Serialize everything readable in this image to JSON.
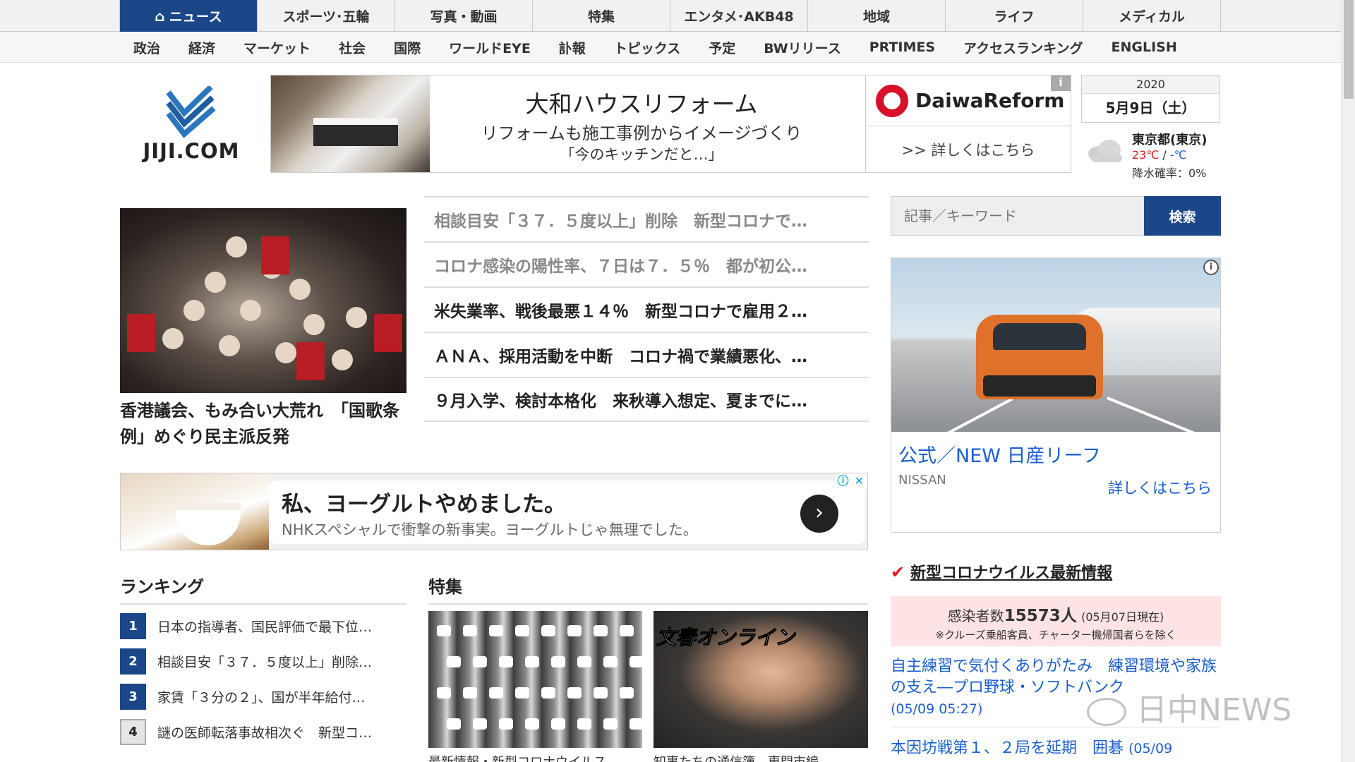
{
  "topnav": {
    "tabs": [
      {
        "label": "ニュース",
        "icon": "home-icon"
      },
      {
        "label": "スポーツ･五輪"
      },
      {
        "label": "写真・動画"
      },
      {
        "label": "特集"
      },
      {
        "label": "エンタメ･AKB48"
      },
      {
        "label": "地域"
      },
      {
        "label": "ライフ"
      },
      {
        "label": "メディカル"
      }
    ],
    "active_color": "#1b4788"
  },
  "subnav": {
    "items": [
      "政治",
      "経済",
      "マーケット",
      "社会",
      "国際",
      "ワールドEYE",
      "訃報",
      "トピックス",
      "予定",
      "BWリリース",
      "PRTIMES",
      "アクセスランキング",
      "ENGLISH"
    ]
  },
  "header": {
    "logo_text": "JIJI.COM",
    "banner": {
      "title": "大和ハウスリフォーム",
      "subtitle": "リフォームも施工事例からイメージづくり",
      "caption": "「今のキッチンだと…」",
      "brand": "DaiwaReform",
      "more": ">> 詳しくはこちら",
      "info": "i"
    },
    "date": {
      "year": "2020",
      "day": "5月9日（土）"
    },
    "weather": {
      "city": "東京都(東京)",
      "high": "23℃",
      "slash": " / ",
      "low": "-℃",
      "rain": "降水確率：0%",
      "icon": "cloud-icon"
    }
  },
  "top_story": {
    "headline": "香港議会、もみ合い大荒れ　「国歌条例」めぐり民主派反発"
  },
  "headlines": [
    {
      "text": "相談目安「３７．５度以上」削除　新型コロナで…",
      "read": true
    },
    {
      "text": "コロナ感染の陽性率、７日は７．５％　都が初公…",
      "read": true
    },
    {
      "text": "米失業率、戦後最悪１４％　新型コロナで雇用２…",
      "read": false
    },
    {
      "text": "ＡＮＡ、採用活動を中断　コロナ禍で業績悪化、…",
      "read": false
    },
    {
      "text": "９月入学、検討本格化　来秋導入想定、夏までに…",
      "read": false
    }
  ],
  "ad_yogurt": {
    "title": "私、ヨーグルトやめました。",
    "desc": "NHKスペシャルで衝撃の新事実。ヨーグルトじゃ無理でした。",
    "go": "›"
  },
  "ranking": {
    "title": "ランキング",
    "items": [
      {
        "num": "1",
        "text": "日本の指導者、国民評価で最下位…"
      },
      {
        "num": "2",
        "text": "相談目安「３７．５度以上」削除…"
      },
      {
        "num": "3",
        "text": "家賃「３分の２」、国が半年給付…"
      },
      {
        "num": "4",
        "text": "謎の医師転落事故相次ぐ　新型コ…"
      }
    ]
  },
  "tokushu": {
    "title": "特集",
    "img2_label": "文春オンライン",
    "captions": [
      "最新情報・新型コロナウイルス",
      "知事たちの通信簿　専門市編"
    ]
  },
  "search": {
    "placeholder": "記事／キーワード",
    "button": "検索"
  },
  "ad_nissan": {
    "headline": "公式／NEW 日産リーフ",
    "sponsor": "NISSAN",
    "cta": "詳しくはこちら"
  },
  "covid": {
    "heading": "新型コロナウイルス最新情報",
    "count_label": "感染者数",
    "count": "15573人",
    "as_of": "(05月07日現在)",
    "note": "※クルーズ乗船客員、チャーター機帰国者らを除く"
  },
  "side_news": [
    {
      "text": "自主練習で気付くありがたみ　練習環境や家族の支え―プロ野球・ソフトバンク",
      "time": "(05/09 05:27)"
    },
    {
      "text": "本因坊戦第１、２局を延期　囲碁",
      "time": "(05/09"
    }
  ],
  "watermark": "日中NEWS"
}
